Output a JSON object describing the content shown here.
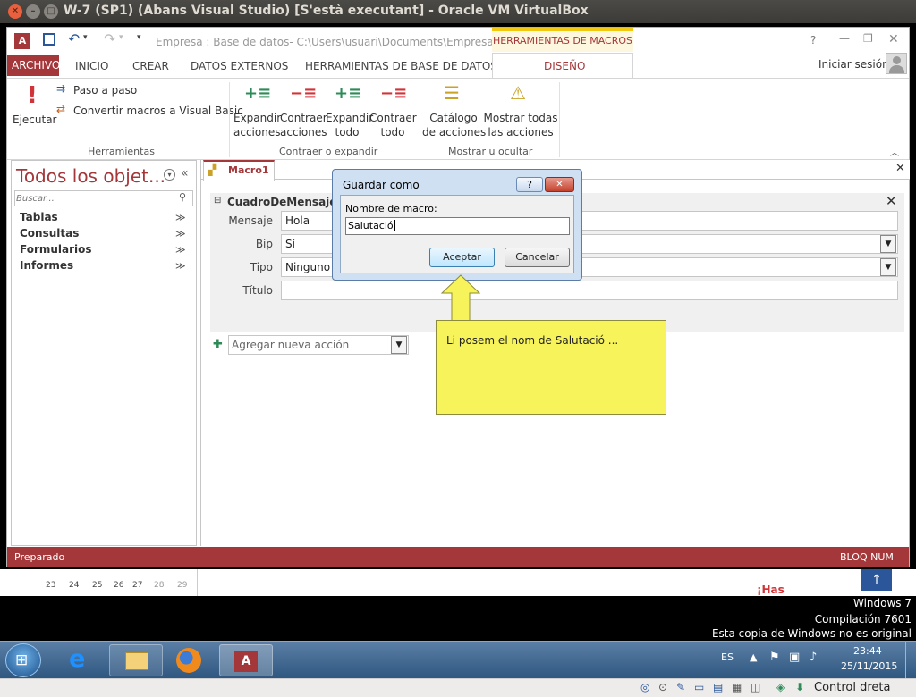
{
  "vbox": {
    "title": "W-7 (SP1) (Abans Visual Studio) [S'està executant] - Oracle VM VirtualBox",
    "right_ctrl": "Control dreta"
  },
  "access": {
    "qat_path": "Empresa : Base de datos- C:\\Users\\usuari\\Documents\\Empresa.acc...",
    "context_tab": "HERRAMIENTAS DE MACROS",
    "help": "?",
    "tabs": [
      "ARCHIVO",
      "INICIO",
      "CREAR",
      "DATOS EXTERNOS",
      "HERRAMIENTAS DE BASE DE DATOS",
      "DISEÑO"
    ],
    "signin": "Iniciar sesión",
    "ribbon": {
      "run_label": "Ejecutar",
      "step_label": "Paso a paso",
      "convert_label": "Convertir macros a Visual Basic",
      "group_tools": "Herramientas",
      "expand_actions": "Expandir\nacciones",
      "collapse_actions": "Contraer\nacciones",
      "expand_all": "Expandir\ntodo",
      "collapse_all": "Contraer\ntodo",
      "group_collapse": "Contraer o expandir",
      "catalog": "Catálogo\nde acciones",
      "show_all": "Mostrar todas\nlas acciones",
      "group_show": "Mostrar u ocultar"
    },
    "nav": {
      "title": "Todos los objet...",
      "search_placeholder": "Buscar...",
      "items": [
        "Tablas",
        "Consultas",
        "Formularios",
        "Informes"
      ]
    },
    "doc_tab": "Macro1",
    "macro": {
      "block": "CuadroDeMensaje",
      "fields": [
        {
          "label": "Mensaje",
          "value": "Hola"
        },
        {
          "label": "Bip",
          "value": "Sí"
        },
        {
          "label": "Tipo",
          "value": "Ninguno"
        },
        {
          "label": "Título",
          "value": ""
        }
      ],
      "add_action": "Agregar nueva acción"
    },
    "status": {
      "left": "Preparado",
      "right": "BLOQ NUM"
    }
  },
  "dialog": {
    "title": "Guardar como",
    "help": "?",
    "close": "✕",
    "label": "Nombre de macro:",
    "value": "Salutació",
    "ok": "Aceptar",
    "cancel": "Cancelar"
  },
  "callout": {
    "text": "Li posem el nom de Salutació ..."
  },
  "strip": {
    "numbers": [
      "23",
      "24",
      "25",
      "26",
      "27",
      "28",
      "29"
    ],
    "red_text": "¡Has"
  },
  "desktop": {
    "line1": "Windows 7",
    "line2": "Compilación  7601",
    "line3": "Esta copia de Windows no es original"
  },
  "taskbar": {
    "lang": "ES",
    "time": "23:44",
    "date": "25/11/2015"
  },
  "colors": {
    "access_red": "#a4373a",
    "context_yellow": "#f2c811",
    "callout": "#f7f35a"
  }
}
